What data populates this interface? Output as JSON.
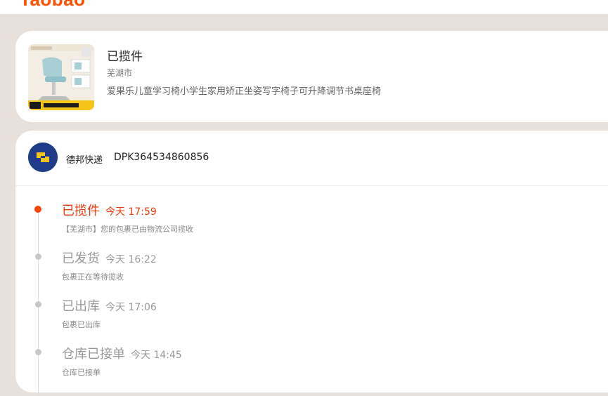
{
  "header": {
    "logo_text": "Taobao",
    "brand_color": "#ff5000"
  },
  "product": {
    "status": "已揽件",
    "city": "芜湖市",
    "title": "爱果乐儿童学习椅小学生家用矫正坐姿写字椅子可升降调节书桌座椅",
    "image_icon": "child-study-chair-photo"
  },
  "courier": {
    "logo_icon": "deppon-logo-icon",
    "name": "德邦快递",
    "tracking_number": "DPK364534860856"
  },
  "timeline": [
    {
      "status": "已揽件",
      "time": "今天 17:59",
      "desc": "【芜湖市】您的包裹已由物流公司揽收",
      "active": true
    },
    {
      "status": "已发货",
      "time": "今天 16:22",
      "desc": "包裹正在等待揽收",
      "active": false
    },
    {
      "status": "已出库",
      "time": "今天 17:06",
      "desc": "包裹已出库",
      "active": false
    },
    {
      "status": "仓库已接单",
      "time": "今天 14:45",
      "desc": "仓库已接单",
      "active": false
    }
  ],
  "colors": {
    "active": "#ee3b0d",
    "inactive": "#999999",
    "background": "#e8e0da"
  }
}
